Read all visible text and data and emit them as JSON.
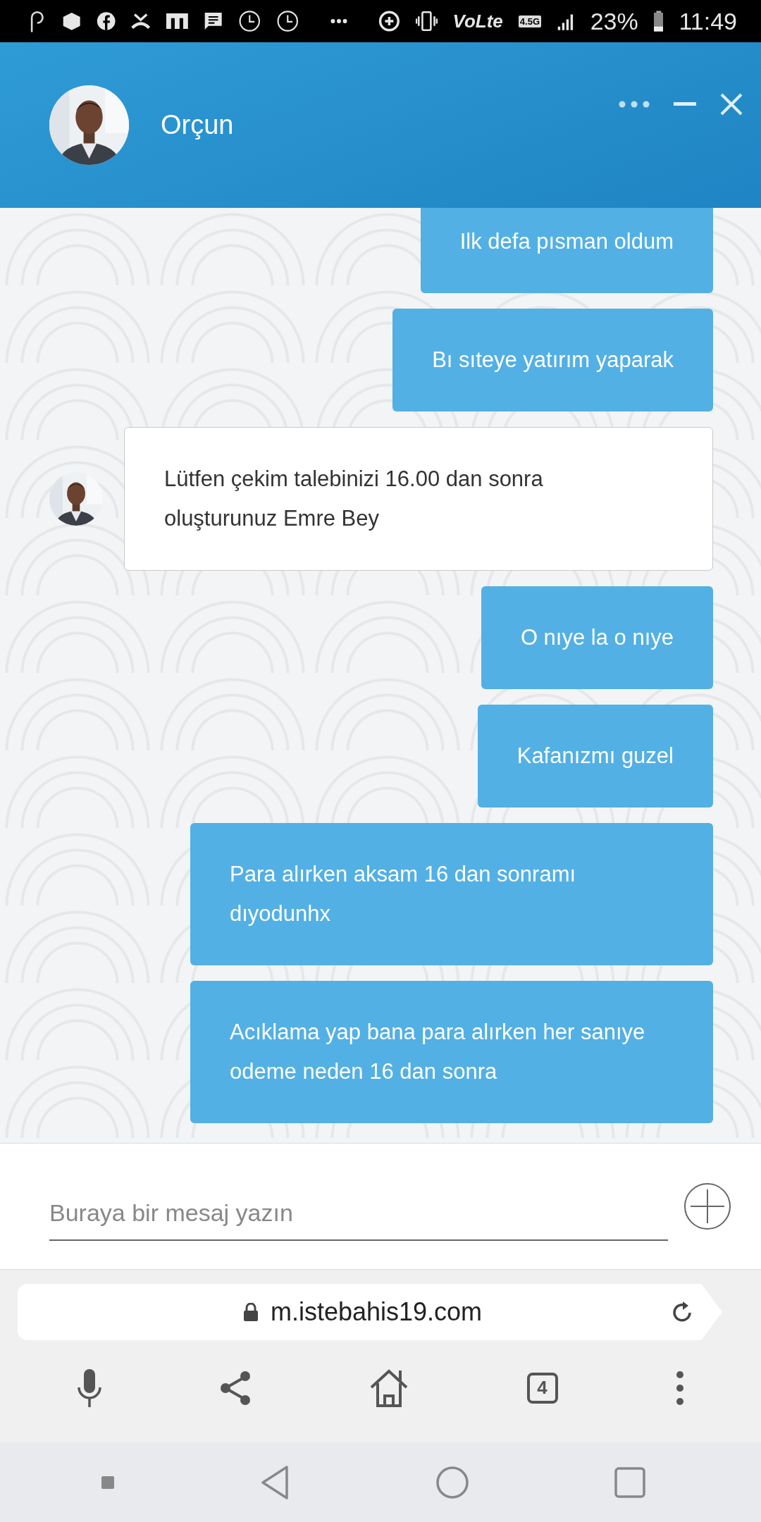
{
  "status_bar": {
    "carrier": "VoLte",
    "network": "4.5G",
    "battery": "23%",
    "time": "11:49"
  },
  "header": {
    "name": "Orçun"
  },
  "messages": [
    {
      "kind": "outgoing",
      "text": "Ilk defa pısman oldum"
    },
    {
      "kind": "outgoing",
      "text": "Bı sıteye yatırım yaparak"
    },
    {
      "kind": "incoming",
      "text": "Lütfen çekim talebinizi 16.00 dan sonra oluşturunuz Emre Bey"
    },
    {
      "kind": "outgoing",
      "text": "O nıye la o nıye"
    },
    {
      "kind": "outgoing",
      "text": "Kafanızmı guzel"
    },
    {
      "kind": "outgoing",
      "text": "Para alırken aksam 16 dan sonramı dıyodunhx"
    },
    {
      "kind": "outgoing",
      "text": "Acıklama yap bana para alırken her sanıye odeme neden 16 dan sonra"
    }
  ],
  "composer": {
    "placeholder": "Buraya bir mesaj yazın"
  },
  "browser": {
    "url": "m.istebahis19.com",
    "tab_count": "4"
  }
}
